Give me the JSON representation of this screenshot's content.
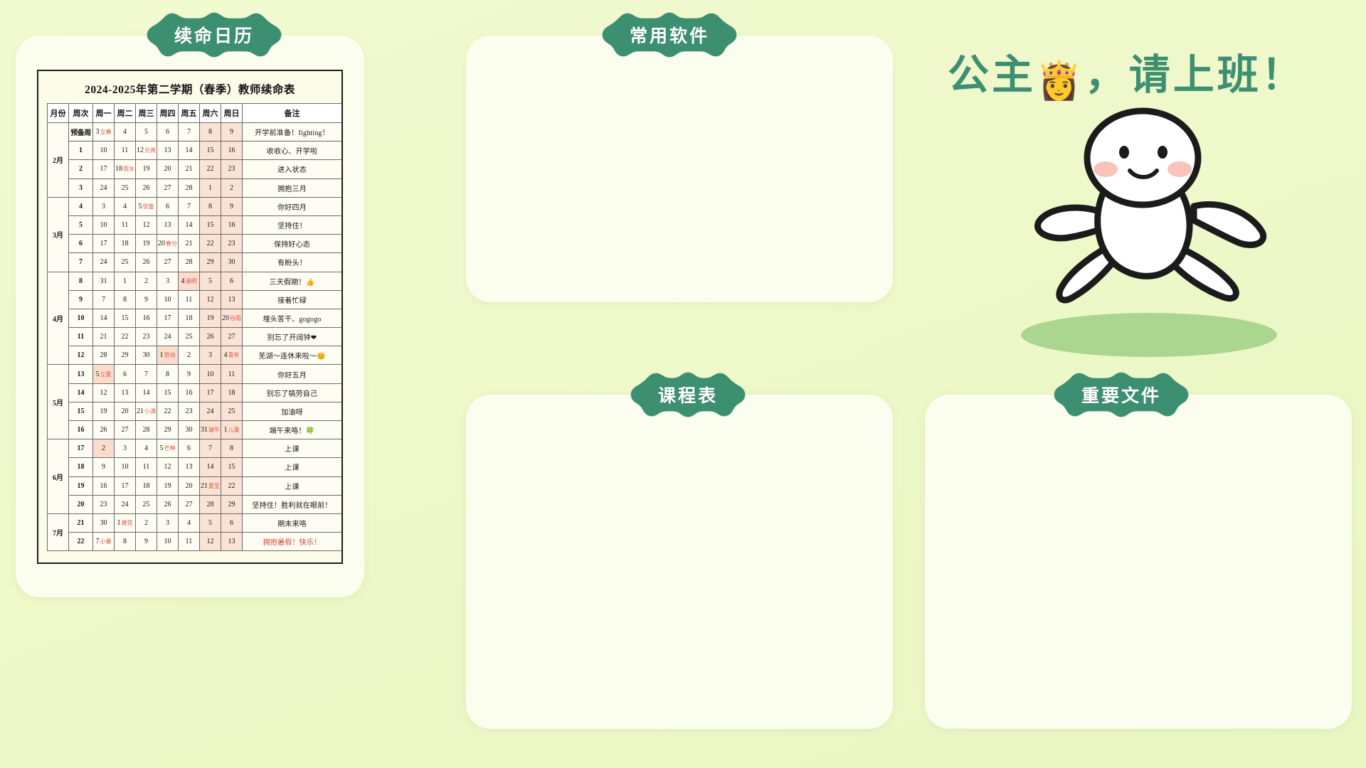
{
  "theme": {
    "page_bg": "#eef8c9",
    "card_bg": "#fbfdee",
    "badge_bg": "#3e8f72",
    "accent_text": "#3e8f72",
    "weekend_bg": "#fae3d5",
    "weekday_bg": "#f2f7ea",
    "festival_red": "#d8443a"
  },
  "badges": {
    "calendar": "续命日历",
    "software": "常用软件",
    "schedule": "课程表",
    "docs": "重要文件"
  },
  "hero": {
    "title_before": "公主",
    "emoji": "👸",
    "title_after": "，请上班！",
    "mascot_name": "white-blob-mascot"
  },
  "calendar": {
    "title": "2024-2025年第二学期（春季）教师续命表",
    "columns": [
      "月份",
      "周次",
      "周一",
      "周二",
      "周三",
      "周四",
      "周五",
      "周六",
      "周日",
      "备注"
    ],
    "months": [
      {
        "label": "2月",
        "rows": 4
      },
      {
        "label": "3月",
        "rows": 4
      },
      {
        "label": "4月",
        "rows": 5
      },
      {
        "label": "5月",
        "rows": 4
      },
      {
        "label": "6月",
        "rows": 4
      },
      {
        "label": "7月",
        "rows": 2
      }
    ],
    "rows": [
      {
        "week": "预备周",
        "days": [
          {
            "n": "3",
            "st": "立春"
          },
          {
            "n": "4"
          },
          {
            "n": "5"
          },
          {
            "n": "6"
          },
          {
            "n": "7"
          },
          {
            "n": "8",
            "we": true
          },
          {
            "n": "9",
            "we": true
          }
        ],
        "note": "开学前准备！fighting！"
      },
      {
        "week": "1",
        "days": [
          {
            "n": "10"
          },
          {
            "n": "11"
          },
          {
            "n": "12",
            "st": "元宵"
          },
          {
            "n": "13"
          },
          {
            "n": "14"
          },
          {
            "n": "15",
            "we": true
          },
          {
            "n": "16",
            "we": true
          }
        ],
        "note": "收收心、开学啦"
      },
      {
        "week": "2",
        "days": [
          {
            "n": "17"
          },
          {
            "n": "18",
            "st": "雨水"
          },
          {
            "n": "19"
          },
          {
            "n": "20"
          },
          {
            "n": "21"
          },
          {
            "n": "22",
            "we": true
          },
          {
            "n": "23",
            "we": true
          }
        ],
        "note": "进入状态"
      },
      {
        "week": "3",
        "days": [
          {
            "n": "24"
          },
          {
            "n": "25"
          },
          {
            "n": "26"
          },
          {
            "n": "27"
          },
          {
            "n": "28"
          },
          {
            "n": "1",
            "we": true
          },
          {
            "n": "2",
            "we": true
          }
        ],
        "note": "拥抱三月"
      },
      {
        "week": "4",
        "days": [
          {
            "n": "3"
          },
          {
            "n": "4"
          },
          {
            "n": "5",
            "st": "惊蛰"
          },
          {
            "n": "6"
          },
          {
            "n": "7"
          },
          {
            "n": "8",
            "we": true
          },
          {
            "n": "9",
            "we": true
          }
        ],
        "note": "你好四月"
      },
      {
        "week": "5",
        "days": [
          {
            "n": "10"
          },
          {
            "n": "11"
          },
          {
            "n": "12"
          },
          {
            "n": "13"
          },
          {
            "n": "14"
          },
          {
            "n": "15",
            "we": true
          },
          {
            "n": "16",
            "we": true
          }
        ],
        "note": "坚持住！"
      },
      {
        "week": "6",
        "days": [
          {
            "n": "17"
          },
          {
            "n": "18"
          },
          {
            "n": "19"
          },
          {
            "n": "20",
            "st": "春分"
          },
          {
            "n": "21"
          },
          {
            "n": "22",
            "we": true
          },
          {
            "n": "23",
            "we": true
          }
        ],
        "note": "保持好心态"
      },
      {
        "week": "7",
        "days": [
          {
            "n": "24"
          },
          {
            "n": "25"
          },
          {
            "n": "26"
          },
          {
            "n": "27"
          },
          {
            "n": "28"
          },
          {
            "n": "29",
            "we": true
          },
          {
            "n": "30",
            "we": true
          }
        ],
        "note": "有盼头！"
      },
      {
        "week": "8",
        "days": [
          {
            "n": "31"
          },
          {
            "n": "1"
          },
          {
            "n": "2"
          },
          {
            "n": "3"
          },
          {
            "n": "4",
            "st": "清明",
            "hl": true
          },
          {
            "n": "5",
            "we": true
          },
          {
            "n": "6",
            "we": true
          }
        ],
        "note": "三天假期！👍"
      },
      {
        "week": "9",
        "days": [
          {
            "n": "7"
          },
          {
            "n": "8"
          },
          {
            "n": "9"
          },
          {
            "n": "10"
          },
          {
            "n": "11"
          },
          {
            "n": "12",
            "we": true
          },
          {
            "n": "13",
            "we": true
          }
        ],
        "note": "接着忙碌"
      },
      {
        "week": "10",
        "days": [
          {
            "n": "14"
          },
          {
            "n": "15"
          },
          {
            "n": "16"
          },
          {
            "n": "17"
          },
          {
            "n": "18"
          },
          {
            "n": "19",
            "we": true
          },
          {
            "n": "20",
            "st": "谷雨",
            "we": true
          }
        ],
        "note": "埋头苦干、gogogo"
      },
      {
        "week": "11",
        "days": [
          {
            "n": "21"
          },
          {
            "n": "22"
          },
          {
            "n": "23"
          },
          {
            "n": "24"
          },
          {
            "n": "25"
          },
          {
            "n": "26",
            "we": true
          },
          {
            "n": "27",
            "we": true
          }
        ],
        "note": "别忘了开阔钟❤"
      },
      {
        "week": "12",
        "days": [
          {
            "n": "28"
          },
          {
            "n": "29"
          },
          {
            "n": "30"
          },
          {
            "n": "1",
            "st": "劳动",
            "hl": true
          },
          {
            "n": "2"
          },
          {
            "n": "3",
            "we": true
          },
          {
            "n": "4",
            "st": "青年",
            "we": true
          }
        ],
        "note": "芜湖～连休来啦～😊"
      },
      {
        "week": "13",
        "days": [
          {
            "n": "5",
            "st": "立夏",
            "hl": true
          },
          {
            "n": "6"
          },
          {
            "n": "7"
          },
          {
            "n": "8"
          },
          {
            "n": "9"
          },
          {
            "n": "10",
            "we": true
          },
          {
            "n": "11",
            "we": true
          }
        ],
        "note": "你好五月"
      },
      {
        "week": "14",
        "days": [
          {
            "n": "12"
          },
          {
            "n": "13"
          },
          {
            "n": "14"
          },
          {
            "n": "15"
          },
          {
            "n": "16"
          },
          {
            "n": "17",
            "we": true
          },
          {
            "n": "18",
            "we": true
          }
        ],
        "note": "别忘了犒劳自己"
      },
      {
        "week": "15",
        "days": [
          {
            "n": "19"
          },
          {
            "n": "20"
          },
          {
            "n": "21",
            "st": "小满"
          },
          {
            "n": "22"
          },
          {
            "n": "23"
          },
          {
            "n": "24",
            "we": true
          },
          {
            "n": "25",
            "we": true
          }
        ],
        "note": "加油呀"
      },
      {
        "week": "16",
        "days": [
          {
            "n": "26"
          },
          {
            "n": "27"
          },
          {
            "n": "28"
          },
          {
            "n": "29"
          },
          {
            "n": "30"
          },
          {
            "n": "31",
            "st": "端午",
            "we": true
          },
          {
            "n": "1",
            "st": "儿童",
            "we": true
          }
        ],
        "note": "端午来咯！🍀"
      },
      {
        "week": "17",
        "days": [
          {
            "n": "2",
            "hl": true
          },
          {
            "n": "3"
          },
          {
            "n": "4"
          },
          {
            "n": "5",
            "st": "芒种"
          },
          {
            "n": "6"
          },
          {
            "n": "7",
            "we": true
          },
          {
            "n": "8",
            "we": true
          }
        ],
        "note": "上课"
      },
      {
        "week": "18",
        "days": [
          {
            "n": "9"
          },
          {
            "n": "10"
          },
          {
            "n": "11"
          },
          {
            "n": "12"
          },
          {
            "n": "13"
          },
          {
            "n": "14",
            "we": true
          },
          {
            "n": "15",
            "we": true
          }
        ],
        "note": "上课"
      },
      {
        "week": "19",
        "days": [
          {
            "n": "16"
          },
          {
            "n": "17"
          },
          {
            "n": "18"
          },
          {
            "n": "19"
          },
          {
            "n": "20"
          },
          {
            "n": "21",
            "st": "夏至",
            "we": true
          },
          {
            "n": "22",
            "we": true
          }
        ],
        "note": "上课"
      },
      {
        "week": "20",
        "days": [
          {
            "n": "23"
          },
          {
            "n": "24"
          },
          {
            "n": "25"
          },
          {
            "n": "26"
          },
          {
            "n": "27"
          },
          {
            "n": "28",
            "we": true
          },
          {
            "n": "29",
            "we": true
          }
        ],
        "note": "坚持住！胜利就在眼前！"
      },
      {
        "week": "21",
        "days": [
          {
            "n": "30"
          },
          {
            "n": "1",
            "st": "建党"
          },
          {
            "n": "2"
          },
          {
            "n": "3"
          },
          {
            "n": "4"
          },
          {
            "n": "5",
            "we": true
          },
          {
            "n": "6",
            "we": true
          }
        ],
        "note": "期末来咯"
      },
      {
        "week": "22",
        "days": [
          {
            "n": "7",
            "st": "小暑"
          },
          {
            "n": "8"
          },
          {
            "n": "9"
          },
          {
            "n": "10"
          },
          {
            "n": "11"
          },
          {
            "n": "12",
            "we": true
          },
          {
            "n": "13",
            "we": true
          }
        ],
        "note": "拥抱暑假！快乐！",
        "note_red": true
      }
    ]
  }
}
